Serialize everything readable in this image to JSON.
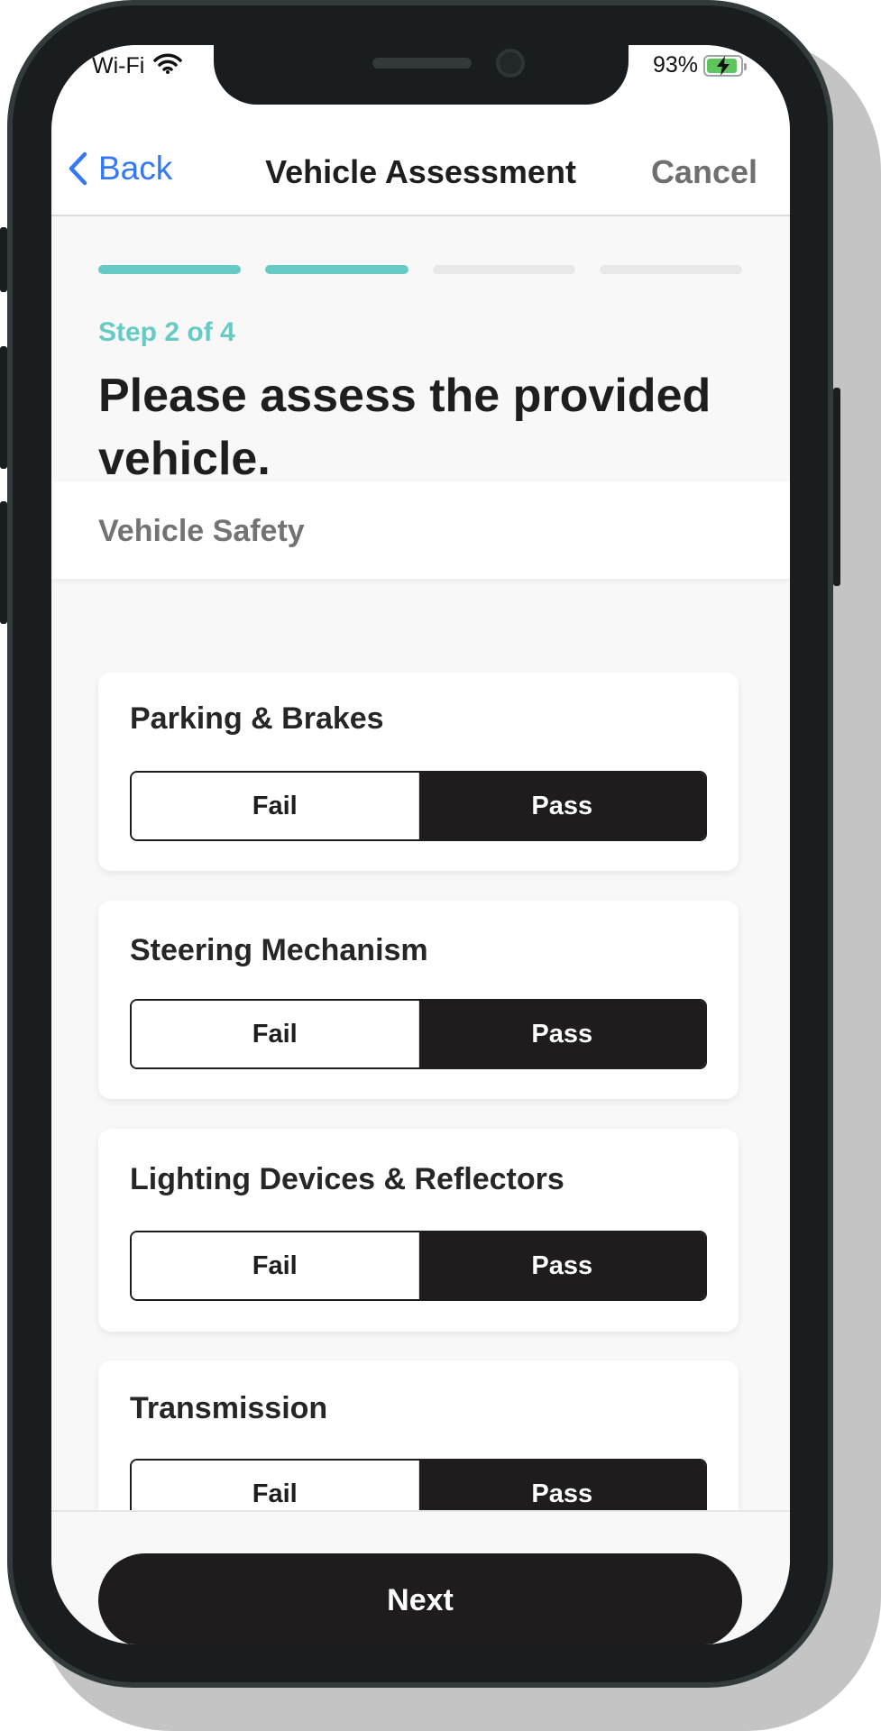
{
  "status_bar": {
    "network": "Wi-Fi",
    "battery_percent": "93%",
    "battery_level": 0.93
  },
  "nav": {
    "back_label": "Back",
    "title": "Vehicle Assessment",
    "cancel_label": "Cancel"
  },
  "progress": {
    "current_step": 2,
    "total_steps": 4,
    "step_label": "Step 2 of 4"
  },
  "main": {
    "heading": "Please assess the provided vehicle.",
    "section_title": "Vehicle Safety",
    "checks": [
      {
        "label": "Parking & Brakes",
        "fail_label": "Fail",
        "pass_label": "Pass",
        "selected": "Pass"
      },
      {
        "label": "Steering Mechanism",
        "fail_label": "Fail",
        "pass_label": "Pass",
        "selected": "Pass"
      },
      {
        "label": "Lighting Devices & Reflectors",
        "fail_label": "Fail",
        "pass_label": "Pass",
        "selected": "Pass"
      },
      {
        "label": "Transmission",
        "fail_label": "Fail",
        "pass_label": "Pass",
        "selected": "Pass"
      }
    ]
  },
  "footer": {
    "next_label": "Next"
  },
  "colors": {
    "accent": "#66cbc4",
    "link": "#3478f6",
    "primary_dark": "#1e1c1d"
  }
}
